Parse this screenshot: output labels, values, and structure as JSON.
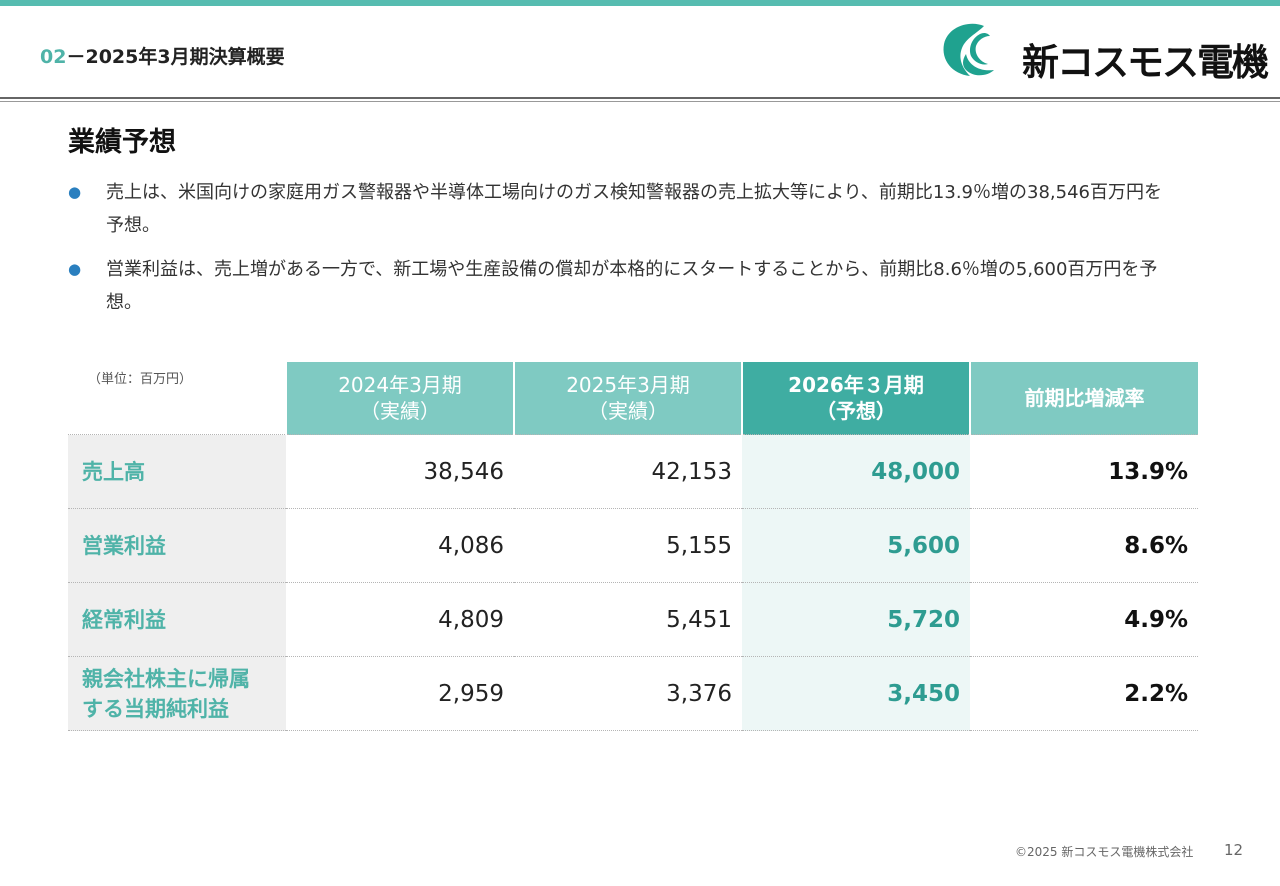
{
  "header": {
    "section_number": "02",
    "section_separator": "－",
    "section_title": "2025年3月期決算概要",
    "logo_text": "新コスモス電機",
    "brand_color": "#1fa28f"
  },
  "title": "業績予想",
  "bullets": [
    "売上は、米国向けの家庭用ガス警報器や半導体工場向けのガス検知警報器の売上拡大等により、前期比13.9％増の38,546百万円を予想。",
    "営業利益は、売上増がある一方で、新工場や生産設備の償却が本格的にスタートすることから、前期比8.6％増の5,600百万円を予想。"
  ],
  "unit_note": "（単位：百万円）",
  "table": {
    "headers": [
      {
        "line1": "2024年3月期",
        "line2": "（実績）"
      },
      {
        "line1": "2025年3月期",
        "line2": "（実績）"
      },
      {
        "line1": "2026年３月期",
        "line2": "（予想）"
      },
      {
        "line1": "前期比増減率",
        "line2": ""
      }
    ],
    "rows": [
      {
        "label": [
          "売上高"
        ],
        "fy2024": "38,546",
        "fy2025": "42,153",
        "fy2026": "48,000",
        "rate": "13.9%"
      },
      {
        "label": [
          "営業利益"
        ],
        "fy2024": "4,086",
        "fy2025": "5,155",
        "fy2026": "5,600",
        "rate": "8.6%"
      },
      {
        "label": [
          "経常利益"
        ],
        "fy2024": "4,809",
        "fy2025": "5,451",
        "fy2026": "5,720",
        "rate": "4.9%"
      },
      {
        "label": [
          "親会社株主に帰属",
          "する当期純利益"
        ],
        "fy2024": "2,959",
        "fy2025": "3,376",
        "fy2026": "3,450",
        "rate": "2.2%"
      }
    ]
  },
  "footer": {
    "copyright": "©2025 新コスモス電機株式会社",
    "page_number": "12"
  }
}
